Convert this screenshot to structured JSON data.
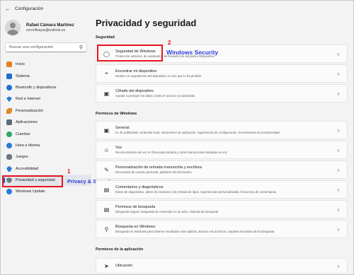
{
  "window": {
    "title": "Configuración"
  },
  "profile": {
    "name": "Rafael Cámara Martínez",
    "email": "zorro4kayos@outlook.es"
  },
  "search": {
    "placeholder": "Buscar una configuración"
  },
  "sidebar": {
    "items": [
      {
        "label": "Inicio",
        "icon": "home-icon",
        "color": "#e67e22"
      },
      {
        "label": "Sistema",
        "icon": "system-icon",
        "color": "#1f6fd1"
      },
      {
        "label": "Bluetooth y dispositivos",
        "icon": "bluetooth-icon",
        "color": "#1f6fd1"
      },
      {
        "label": "Red e Internet",
        "icon": "network-icon",
        "color": "#2a7bd8"
      },
      {
        "label": "Personalización",
        "icon": "brush-icon",
        "color": "#e08a2a"
      },
      {
        "label": "Aplicaciones",
        "icon": "apps-icon",
        "color": "#5a6b7d"
      },
      {
        "label": "Cuentas",
        "icon": "accounts-icon",
        "color": "#2fa56a"
      },
      {
        "label": "Hora e idioma",
        "icon": "clock-globe-icon",
        "color": "#2a7bd8"
      },
      {
        "label": "Juegos",
        "icon": "gamepad-icon",
        "color": "#6f7780"
      },
      {
        "label": "Accesibilidad",
        "icon": "accessibility-icon",
        "color": "#2a7bd8"
      },
      {
        "label": "Privacidad y seguridad",
        "icon": "shield-icon",
        "color": "#6f7780"
      },
      {
        "label": "Windows Update",
        "icon": "update-icon",
        "color": "#2a7bd8"
      }
    ]
  },
  "annotations": {
    "num1": "1",
    "text1": "Privacy & Security",
    "num2": "2",
    "text2": "Windows Security"
  },
  "main": {
    "title": "Privacidad y seguridad",
    "sections": {
      "seguridad": "Seguridad",
      "permisos_windows": "Permisos de Windows",
      "permisos_app": "Permisos de la aplicación"
    },
    "cards": [
      {
        "title": "Seguridad de Windows",
        "subtitle": "Protección antivirus, de explorador, de firewall y de red para el dispositivo",
        "icon": "shield-icon"
      },
      {
        "title": "Encontrar mi dispositivo",
        "subtitle": "Realice un seguimiento del dispositivo si cree que lo ha perdido",
        "icon": "locate-icon"
      },
      {
        "title": "Cifrado del dispositivo",
        "subtitle": "Ayudar a proteger los datos contra el acceso no autorizado",
        "icon": "lock-icon"
      },
      {
        "title": "General",
        "subtitle": "Id. de publicidad, contenido local, iniciaciones de aplicación, sugerencias de configuración, herramientas de productividad",
        "icon": "lock-icon"
      },
      {
        "title": "Voz",
        "subtitle": "Reconocimiento de voz en línea para dictado y otras interacciones basadas en voz",
        "icon": "person-voice-icon"
      },
      {
        "title": "Personalización de entrada manuscrita y escritura",
        "subtitle": "Diccionario de usuario personal, palabras del diccionario",
        "icon": "pen-icon"
      },
      {
        "title": "Comentarios y diagnósticos",
        "subtitle": "Datos de diagnóstico, datos de escritura y de entrada de lápiz, experiencias personalizadas, frecuencia de comentarios",
        "icon": "feedback-icon"
      },
      {
        "title": "Permisos de búsqueda",
        "subtitle": "Búsqueda segura, búsqueda de contenido en la nube, historial de búsqueda",
        "icon": "search-permission-icon"
      },
      {
        "title": "Búsqueda en Windows",
        "subtitle": "Búsqueda en Windows para obtener resultados más rápidos, Buscar mis archivos, carpetas excluidas de la búsqueda",
        "icon": "search-icon"
      },
      {
        "title": "Ubicación",
        "subtitle": "",
        "icon": "location-icon"
      }
    ]
  }
}
